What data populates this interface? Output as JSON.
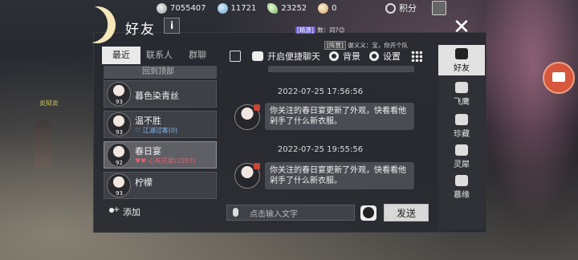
{
  "resources": [
    {
      "icon": "coin-icon",
      "value": "7055407"
    },
    {
      "icon": "gem-icon",
      "value": "11721"
    },
    {
      "icon": "leaf-icon",
      "value": "23252"
    },
    {
      "icon": "bag-icon",
      "value": "0"
    }
  ],
  "jifen_label": "积分",
  "npc_name": "炎狱炎",
  "panel": {
    "title": "好友",
    "info_label": "i",
    "close_label": "✕",
    "ticker": {
      "tag": "[精源]",
      "text": "数：同?😊"
    },
    "ticker2": {
      "tag": "[阵营]",
      "text": "谢义义：宝，你开个队"
    }
  },
  "tabs": [
    "最近",
    "联系人",
    "群聊"
  ],
  "back_to_top": "回到顶部",
  "friends": [
    {
      "name": "暮色染青丝",
      "level": "93",
      "sub": ""
    },
    {
      "name": "温不胜",
      "level": "93",
      "sub": "♡ 江湖过客(0)"
    },
    {
      "name": "春日宴",
      "level": "92",
      "sub": "♥♥ 心有灵犀(2053)"
    },
    {
      "name": "柠檬",
      "level": "93",
      "sub": ""
    }
  ],
  "add_label": "添加",
  "toolbar": {
    "quick_chat": "开启便捷聊天",
    "background": "背景",
    "settings": "设置"
  },
  "messages": [
    {
      "timestamp": "2022-07-25 17:56:56",
      "text": "你关注的春日宴更新了外观，快看看他剁手了什么新衣服。"
    },
    {
      "timestamp": "2022-07-25 19:55:56",
      "text": "你关注的春日宴更新了外观，快看看他剁手了什么新衣服。"
    }
  ],
  "input_placeholder": "点击输入文字",
  "send_label": "发送",
  "sidebar": [
    {
      "label": "好友",
      "icon": "friends-icon"
    },
    {
      "label": "飞鹰",
      "icon": "eagle-icon"
    },
    {
      "label": "珍藏",
      "icon": "collection-icon"
    },
    {
      "label": "灵犀",
      "icon": "rhino-icon"
    },
    {
      "label": "慕缘",
      "icon": "fate-icon"
    }
  ]
}
